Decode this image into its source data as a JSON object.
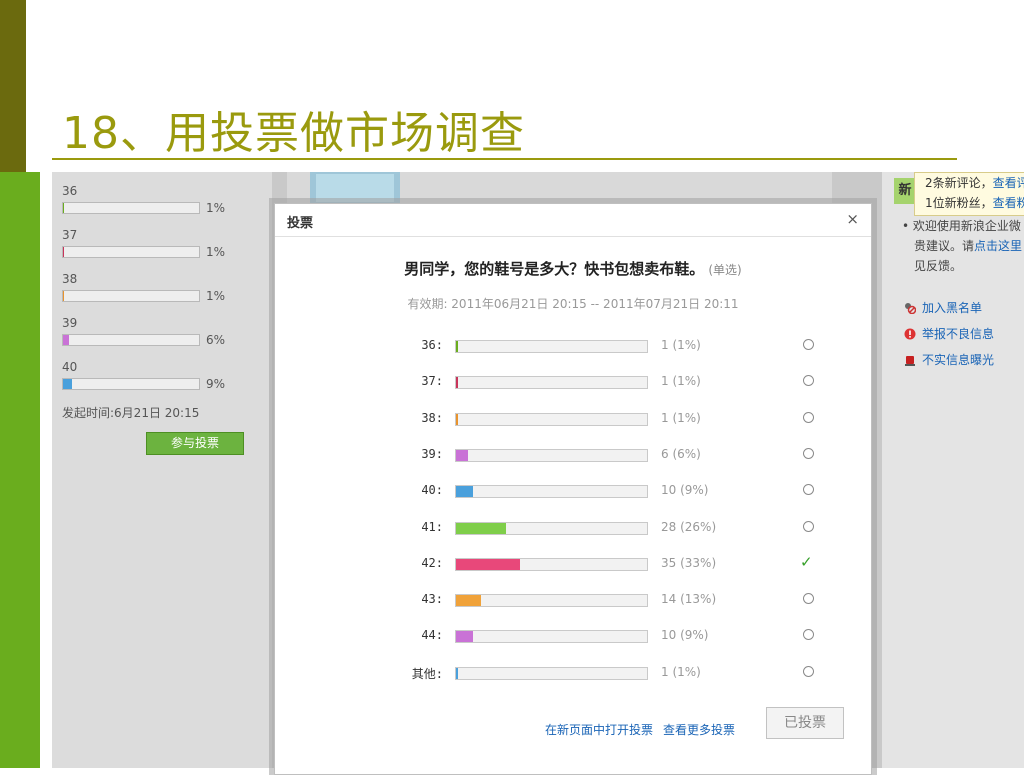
{
  "slide": {
    "title": "18、用投票做市场调查"
  },
  "background_poll": {
    "rows": [
      {
        "label": "36",
        "pct": "1%",
        "fill": 0.01,
        "color": "#6aad1e"
      },
      {
        "label": "37",
        "pct": "1%",
        "fill": 0.01,
        "color": "#c8345a"
      },
      {
        "label": "38",
        "pct": "1%",
        "fill": 0.01,
        "color": "#e8932d"
      },
      {
        "label": "39",
        "pct": "6%",
        "fill": 0.06,
        "color": "#c972d6"
      },
      {
        "label": "40",
        "pct": "9%",
        "fill": 0.09,
        "color": "#4aa0dc"
      }
    ],
    "time_label": "发起时间:6月21日  20:15",
    "vote_button": "参与投票"
  },
  "right_panel": {
    "tab_char": "新",
    "notify_line1": "2条新评论，",
    "notify_link1": "查看评",
    "notify_line2": "1位新粉丝，",
    "notify_link2": "查看粉",
    "welcome_1": "• 欢迎使用新浪企业微",
    "welcome_2a": "贵建议。请",
    "welcome_2b": "点击这里",
    "welcome_3": "见反馈。",
    "blacklist": "加入黑名单",
    "report": "举报不良信息",
    "false_info": "不实信息曝光"
  },
  "dialog": {
    "title": "投票",
    "close": "×",
    "question": "男同学，您的鞋号是多大？快书包想卖布鞋。",
    "question_type": "(单选)",
    "validity": "有效期:  2011年06月21日  20:15 -- 2011年07月21日  20:11",
    "options": [
      {
        "label": "36:",
        "count": "1 (1%)",
        "fill": 0.01,
        "color": "#6aad1e",
        "checked": false
      },
      {
        "label": "37:",
        "count": "1 (1%)",
        "fill": 0.01,
        "color": "#c8345a",
        "checked": false
      },
      {
        "label": "38:",
        "count": "1 (1%)",
        "fill": 0.01,
        "color": "#e8932d",
        "checked": false
      },
      {
        "label": "39:",
        "count": "6 (6%)",
        "fill": 0.06,
        "color": "#c972d6",
        "checked": false
      },
      {
        "label": "40:",
        "count": "10 (9%)",
        "fill": 0.09,
        "color": "#4aa0dc",
        "checked": false
      },
      {
        "label": "41:",
        "count": "28 (26%)",
        "fill": 0.26,
        "color": "#7fce4a",
        "checked": false
      },
      {
        "label": "42:",
        "count": "35 (33%)",
        "fill": 0.33,
        "color": "#e8487a",
        "checked": true
      },
      {
        "label": "43:",
        "count": "14 (13%)",
        "fill": 0.13,
        "color": "#f0a23a",
        "checked": false
      },
      {
        "label": "44:",
        "count": "10 (9%)",
        "fill": 0.09,
        "color": "#c972d6",
        "checked": false
      },
      {
        "label": "其他:",
        "count": "1 (1%)",
        "fill": 0.01,
        "color": "#4aa0dc",
        "checked": false
      }
    ],
    "link_open": "在新页面中打开投票",
    "link_more": "查看更多投票",
    "voted_button": "已投票"
  }
}
